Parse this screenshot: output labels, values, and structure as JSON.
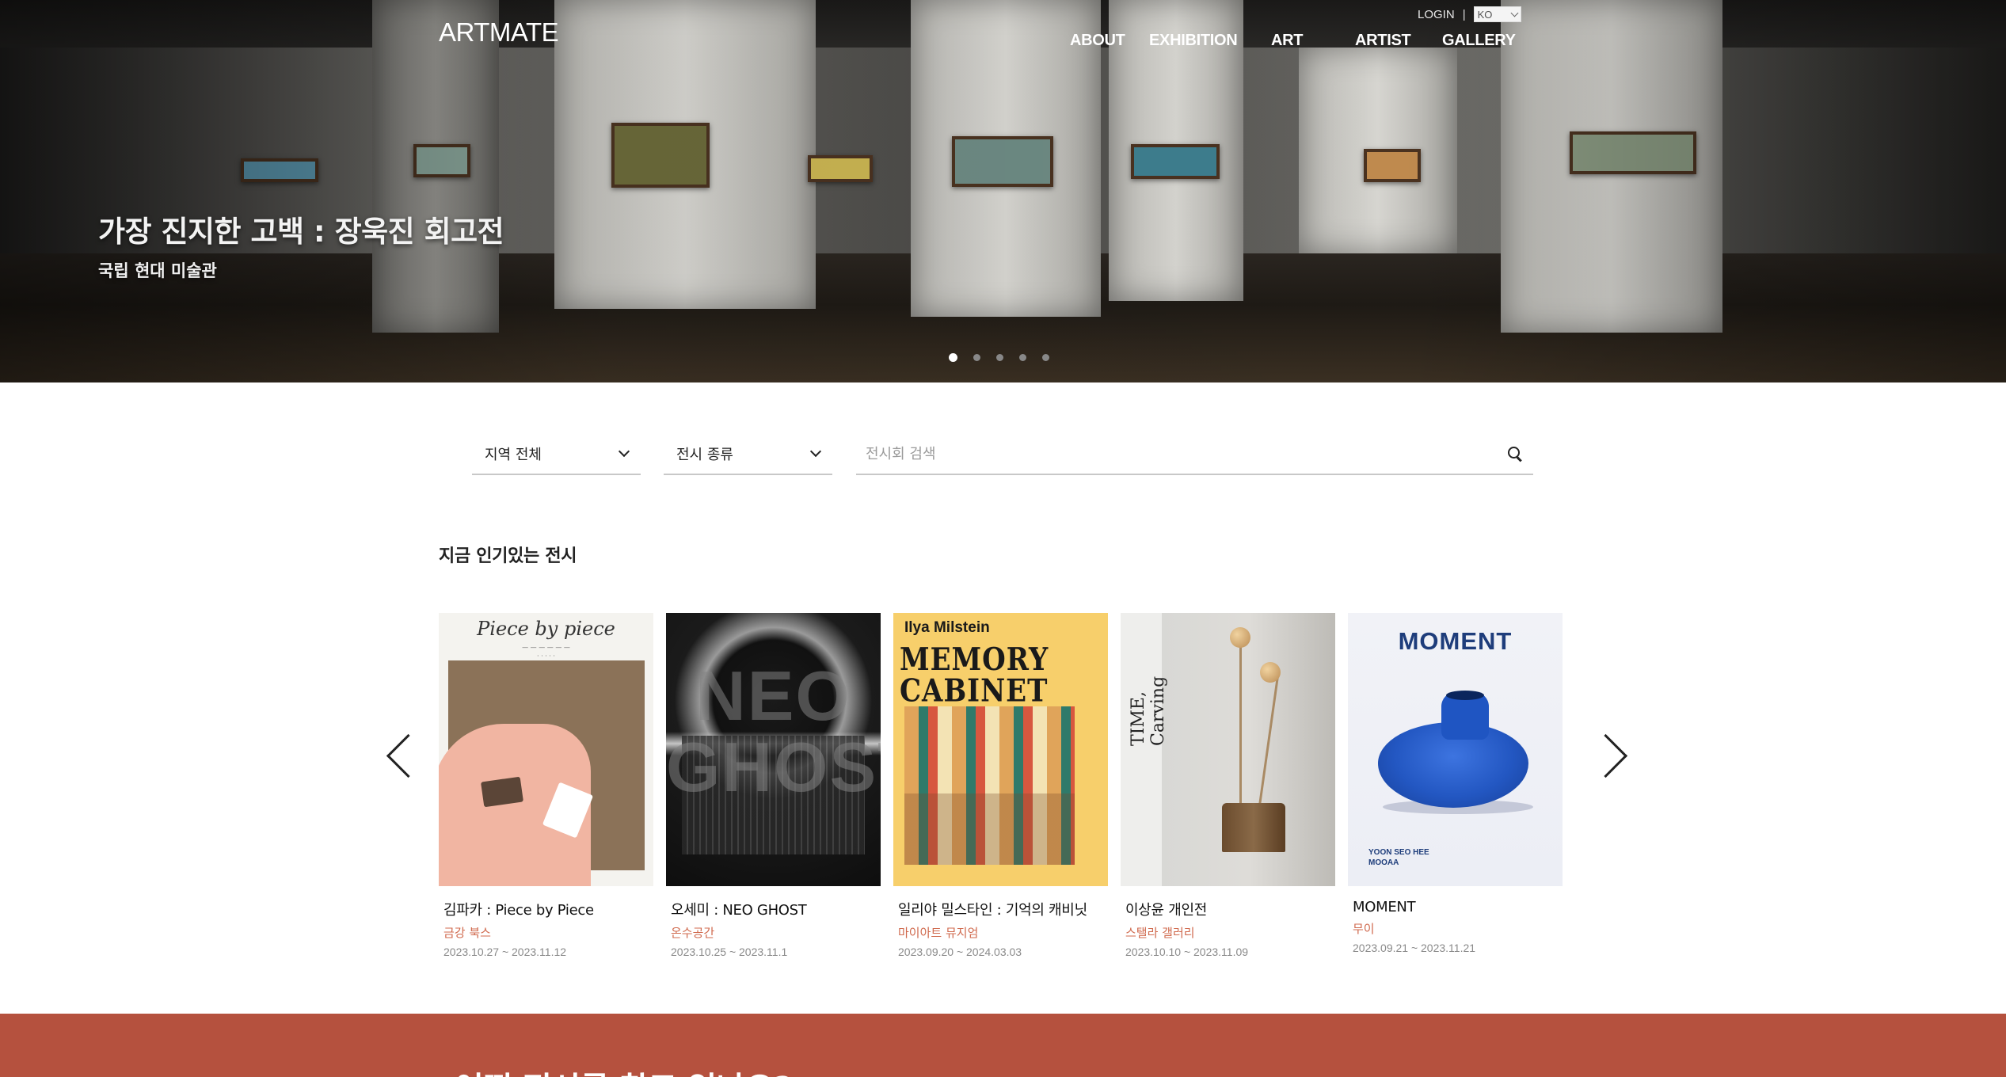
{
  "header": {
    "logo": "ARTMATE",
    "utility": {
      "login": "LOGIN",
      "separator": "|",
      "lang": "KO"
    },
    "nav": [
      "ABOUT",
      "EXHIBITION",
      "ART",
      "ARTIST",
      "GALLERY"
    ]
  },
  "hero": {
    "title": "가장 진지한 고백 : 장욱진 회고전",
    "subtitle": "국립 현대 미술관",
    "slide_count": 5,
    "active_slide": 1
  },
  "filters": {
    "region": "지역 전체",
    "type": "전시 종류",
    "search_placeholder": "전시회 검색"
  },
  "popular": {
    "title": "지금 인기있는 전시",
    "items": [
      {
        "title": "김파카 : Piece by Piece",
        "venue": "금강 북스",
        "dates": "2023.10.27 ~ 2023.11.12",
        "poster_text": "Piece by piece"
      },
      {
        "title": "오세미 : NEO GHOST",
        "venue": "온수공간",
        "dates": "2023.10.25 ~ 2023.11.1",
        "poster_text": "NEO GHOST"
      },
      {
        "title": "일리야 밀스타인 : 기억의 캐비닛",
        "venue": "마이아트 뮤지엄",
        "dates": "2023.09.20 ~ 2024.03.03",
        "poster_text": "Ilya Milstein",
        "poster_text2": "MEMORY CABINET"
      },
      {
        "title": "이상윤 개인전",
        "venue": "스탤라 갤러리",
        "dates": "2023.10.10 ~ 2023.11.09",
        "poster_text": "TIME, Carving"
      },
      {
        "title": "MOMENT",
        "venue": "무이",
        "dates": "2023.09.21 ~ 2023.11.21",
        "poster_text": "MOMENT",
        "poster_text2": "YOON SEO HEE",
        "poster_text3": "MOOAA"
      }
    ]
  },
  "bottom": {
    "question": "어떤 전시를 찾고 있나요?"
  },
  "colors": {
    "accent": "#b5513e",
    "venue": "#d06a4e",
    "moment_blue": "#1f55c2"
  }
}
